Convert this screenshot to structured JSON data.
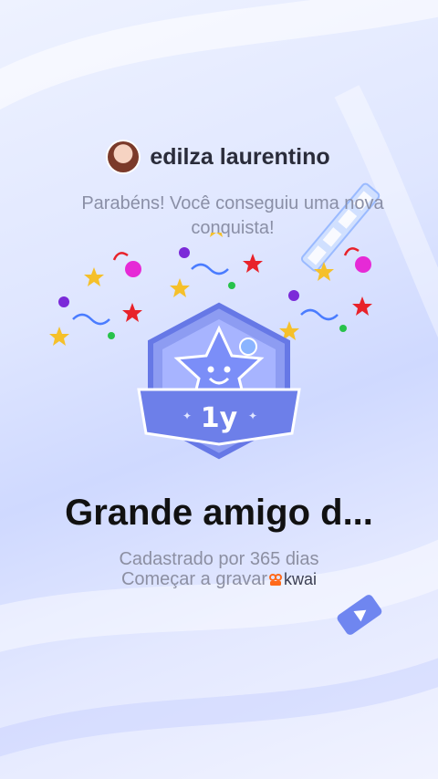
{
  "user": {
    "name": "edilza laurentino"
  },
  "congrats_text": "Parabéns! Você conseguiu uma nova conquista!",
  "badge": {
    "year_label": "1y"
  },
  "achievement": {
    "title": "Grande amigo d...",
    "registered_text": "Cadastrado por 365 dias",
    "record_text": "Começar a gravar",
    "brand": "kwai"
  },
  "colors": {
    "badge": "#7f8ff0",
    "badge_light": "#c9d3ff",
    "text_dark": "#111111",
    "text_muted": "#8c8fa2",
    "brand": "#ff6a1a"
  }
}
